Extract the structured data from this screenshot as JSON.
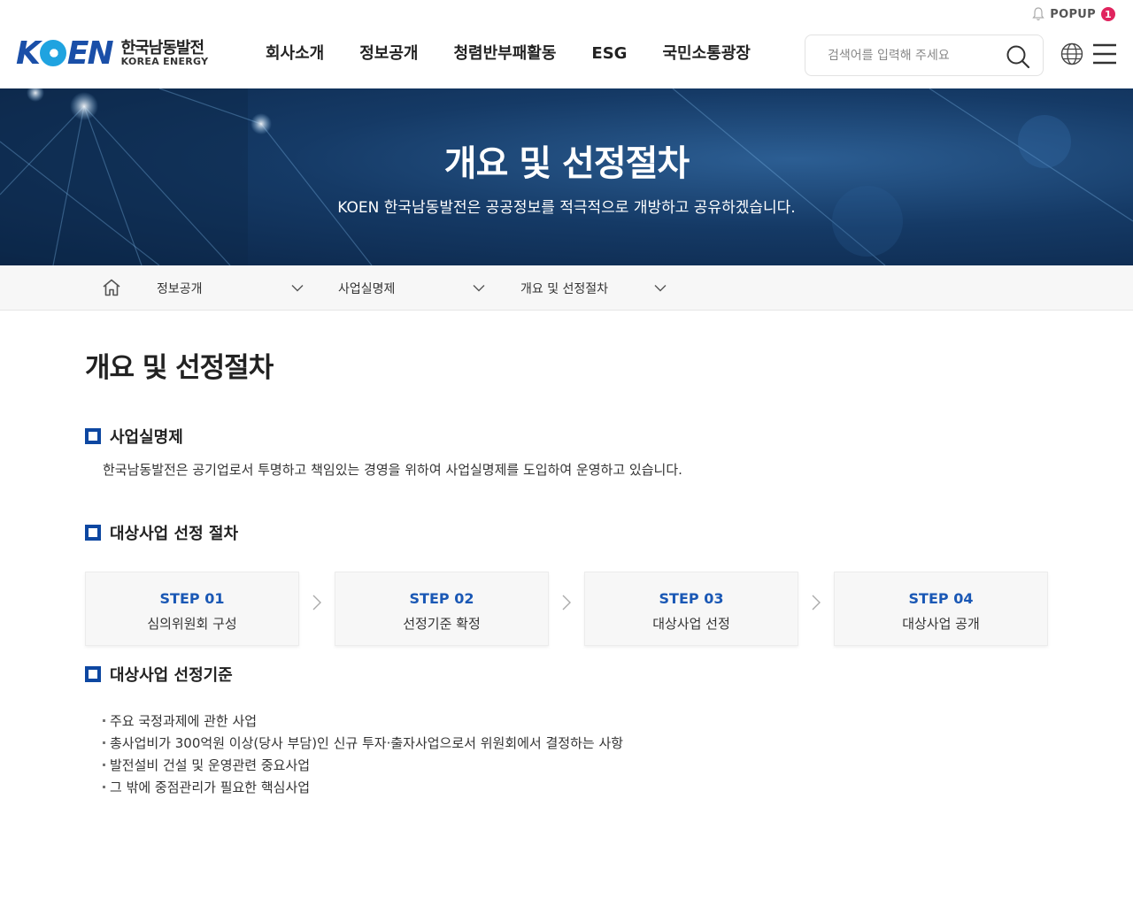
{
  "header": {
    "popup_label": "POPUP",
    "popup_count": "1",
    "logo": {
      "mark": "KOEN",
      "name_ko": "한국남동발전",
      "name_en": "KOREA ENERGY"
    },
    "nav": [
      "회사소개",
      "정보공개",
      "청렴반부패활동",
      "ESG",
      "국민소통광장"
    ],
    "search": {
      "placeholder": "검색어를 입력해 주세요",
      "value": ""
    },
    "icons": [
      "bell-icon",
      "search-icon",
      "globe-icon",
      "hamburger-menu-icon"
    ]
  },
  "banner": {
    "title": "개요 및 선정절차",
    "subtitle": "KOEN 한국남동발전은 공공정보를 적극적으로 개방하고 공유하겠습니다."
  },
  "location": {
    "items": [
      "정보공개",
      "사업실명제",
      "개요 및 선정절차"
    ]
  },
  "content": {
    "page_title": "개요 및 선정절차",
    "section1": {
      "title": "사업실명제",
      "desc": "한국남동발전은 공기업로서 투명하고 책임있는 경영을 위하여 사업실명제를 도입하여 운영하고 있습니다."
    },
    "section2": {
      "title": "대상사업 선정 절차",
      "steps": [
        {
          "num": "STEP 01",
          "label": "심의위원회 구성"
        },
        {
          "num": "STEP 02",
          "label": "선정기준 확정"
        },
        {
          "num": "STEP 03",
          "label": "대상사업 선정"
        },
        {
          "num": "STEP 04",
          "label": "대상사업 공개"
        }
      ]
    },
    "section3": {
      "title": "대상사업 선정기준",
      "items": [
        "주요 국정과제에 관한 사업",
        "총사업비가 300억원 이상(당사 부담)인 신규 투자·출자사업으로서 위원회에서 결정하는 사항",
        "발전설비 건설 및 운영관련 중요사업",
        "그 밖에 중점관리가 필요한 핵심사업"
      ]
    }
  },
  "colors": {
    "brand_blue": "#0d47a1",
    "step_blue": "#1a58b5",
    "badge_red": "#e0245e"
  }
}
